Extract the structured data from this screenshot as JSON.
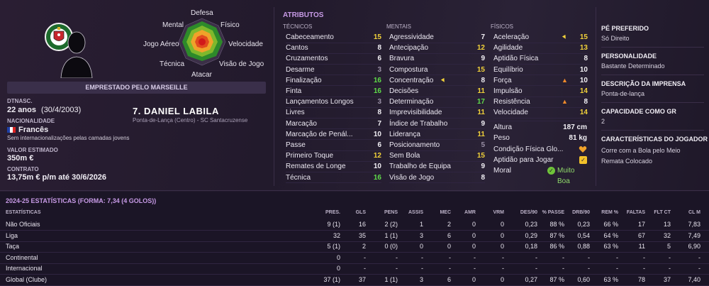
{
  "player": {
    "loan_banner": "EMPRESTADO PELO MARSEILLE",
    "name": "7. DANIEL LABILA",
    "position_club": "Ponta-de-Lança (Centro) - SC Santacruzense",
    "dob_label": "DTNASC.",
    "age": "22 anos",
    "dob": "(30/4/2003)",
    "nationality_label": "NACIONALIDADE",
    "nationality": "Francês",
    "international_note": "Sem internacionalizações pelas camadas jovens",
    "value_label": "VALOR ESTIMADO",
    "value": "350m €",
    "contract_label": "CONTRATO",
    "contract": "13,75m € p/m até 30/6/2026"
  },
  "radar": {
    "labels": {
      "top": "Defesa",
      "top_left": "Mental",
      "top_right": "Físico",
      "left": "Jogo Aéreo",
      "right": "Velocidade",
      "bottom_left": "Técnica",
      "bottom_right": "Visão de Jogo",
      "bottom": "Atacar"
    }
  },
  "attributes": {
    "title": "ATRIBUTOS",
    "technical_head": "TÉCNICOS",
    "mental_head": "MENTAIS",
    "physical_head": "FÍSICOS",
    "technical": [
      {
        "name": "Cabeceamento",
        "value": "15",
        "color": "yellow"
      },
      {
        "name": "Cantos",
        "value": "8",
        "color": "white"
      },
      {
        "name": "Cruzamentos",
        "value": "6",
        "color": "white"
      },
      {
        "name": "Desarme",
        "value": "3",
        "color": "grey"
      },
      {
        "name": "Finalização",
        "value": "16",
        "color": "green"
      },
      {
        "name": "Finta",
        "value": "16",
        "color": "green"
      },
      {
        "name": "Lançamentos Longos",
        "value": "3",
        "color": "grey"
      },
      {
        "name": "Livres",
        "value": "8",
        "color": "white"
      },
      {
        "name": "Marcação",
        "value": "7",
        "color": "white"
      },
      {
        "name": "Marcação de Penál...",
        "value": "10",
        "color": "white"
      },
      {
        "name": "Passe",
        "value": "6",
        "color": "white"
      },
      {
        "name": "Primeiro Toque",
        "value": "12",
        "color": "yellow"
      },
      {
        "name": "Remates de Longe",
        "value": "10",
        "color": "white"
      },
      {
        "name": "Técnica",
        "value": "16",
        "color": "green"
      }
    ],
    "mental": [
      {
        "name": "Agressividade",
        "value": "7",
        "color": "white",
        "icon": ""
      },
      {
        "name": "Antecipação",
        "value": "12",
        "color": "yellow",
        "icon": ""
      },
      {
        "name": "Bravura",
        "value": "9",
        "color": "white",
        "icon": ""
      },
      {
        "name": "Compostura",
        "value": "15",
        "color": "yellow",
        "icon": ""
      },
      {
        "name": "Concentração",
        "value": "8",
        "color": "white",
        "icon": "arrow-down-yellow"
      },
      {
        "name": "Decisões",
        "value": "11",
        "color": "yellow",
        "icon": ""
      },
      {
        "name": "Determinação",
        "value": "17",
        "color": "green",
        "icon": ""
      },
      {
        "name": "Imprevisibilidade",
        "value": "11",
        "color": "yellow",
        "icon": ""
      },
      {
        "name": "Índice de Trabalho",
        "value": "9",
        "color": "white",
        "icon": ""
      },
      {
        "name": "Liderança",
        "value": "11",
        "color": "yellow",
        "icon": ""
      },
      {
        "name": "Posicionamento",
        "value": "5",
        "color": "grey",
        "icon": ""
      },
      {
        "name": "Sem Bola",
        "value": "15",
        "color": "yellow",
        "icon": ""
      },
      {
        "name": "Trabalho de Equipa",
        "value": "9",
        "color": "white",
        "icon": ""
      },
      {
        "name": "Visão de Jogo",
        "value": "8",
        "color": "white",
        "icon": ""
      }
    ],
    "physical": [
      {
        "name": "Aceleração",
        "value": "15",
        "color": "yellow",
        "icon": "arrow-down-yellow"
      },
      {
        "name": "Agilidade",
        "value": "13",
        "color": "yellow",
        "icon": ""
      },
      {
        "name": "Aptidão Física",
        "value": "8",
        "color": "white",
        "icon": ""
      },
      {
        "name": "Equilíbrio",
        "value": "10",
        "color": "white",
        "icon": ""
      },
      {
        "name": "Força",
        "value": "10",
        "color": "white",
        "icon": "arrow-up-orange"
      },
      {
        "name": "Impulsão",
        "value": "14",
        "color": "yellow",
        "icon": ""
      },
      {
        "name": "Resistência",
        "value": "8",
        "color": "white",
        "icon": "arrow-up-orange"
      },
      {
        "name": "Velocidade",
        "value": "14",
        "color": "yellow",
        "icon": ""
      }
    ],
    "physical_info": [
      {
        "label": "Altura",
        "value": "187 cm"
      },
      {
        "label": "Peso",
        "value": "81 kg"
      },
      {
        "label": "Condição Física Glo...",
        "value": ""
      },
      {
        "label": "Aptidão para Jogar",
        "value": ""
      },
      {
        "label": "Moral",
        "value": "Muito Boa"
      }
    ]
  },
  "right_panel": {
    "foot_head": "PÉ PREFERIDO",
    "foot": "Só Direito",
    "personality_head": "PERSONALIDADE",
    "personality": "Bastante Determinado",
    "media_head": "DESCRIÇÃO DA IMPRENSA",
    "media": "Ponta-de-lança",
    "gk_head": "CAPACIDADE COMO GR",
    "gk": "2",
    "traits_head": "CARACTERÍSTICAS DO JOGADOR",
    "traits": [
      "Corre com a Bola pelo Meio",
      "Remata Colocado"
    ]
  },
  "stats": {
    "title": "2024-25 ESTATÍSTICAS (FORMA: 7,34 (4 GOLOS))",
    "label_head": "ESTATÍSTICAS",
    "headers": [
      "PRES.",
      "GLS",
      "PENS",
      "ASSIS",
      "MEC",
      "AMR",
      "VRM",
      "DES/90",
      "% PASSE",
      "DRB/90",
      "REM %",
      "FALTAS",
      "FLT CT",
      "CL M"
    ],
    "rows": [
      {
        "label": "Não Oficiais",
        "cells": [
          "9 (1)",
          "16",
          "2 (2)",
          "1",
          "2",
          "0",
          "0",
          "0,23",
          "88 %",
          "0,23",
          "66 %",
          "17",
          "13",
          "7,83"
        ]
      },
      {
        "label": "Liga",
        "cells": [
          "32",
          "35",
          "1 (1)",
          "3",
          "6",
          "0",
          "0",
          "0,29",
          "87 %",
          "0,54",
          "64 %",
          "67",
          "32",
          "7,49"
        ]
      },
      {
        "label": "Taça",
        "cells": [
          "5 (1)",
          "2",
          "0 (0)",
          "0",
          "0",
          "0",
          "0",
          "0,18",
          "86 %",
          "0,88",
          "63 %",
          "11",
          "5",
          "6,90"
        ]
      },
      {
        "label": "Continental",
        "cells": [
          "0",
          "-",
          "-",
          "-",
          "-",
          "-",
          "-",
          "-",
          "-",
          "-",
          "-",
          "-",
          "-",
          "-"
        ]
      },
      {
        "label": "Internacional",
        "cells": [
          "0",
          "-",
          "-",
          "-",
          "-",
          "-",
          "-",
          "-",
          "-",
          "-",
          "-",
          "-",
          "-",
          "-"
        ]
      },
      {
        "label": "Global (Clube)",
        "cells": [
          "37 (1)",
          "37",
          "1 (1)",
          "3",
          "6",
          "0",
          "0",
          "0,27",
          "87 %",
          "0,60",
          "63 %",
          "78",
          "37",
          "7,40"
        ]
      }
    ]
  }
}
